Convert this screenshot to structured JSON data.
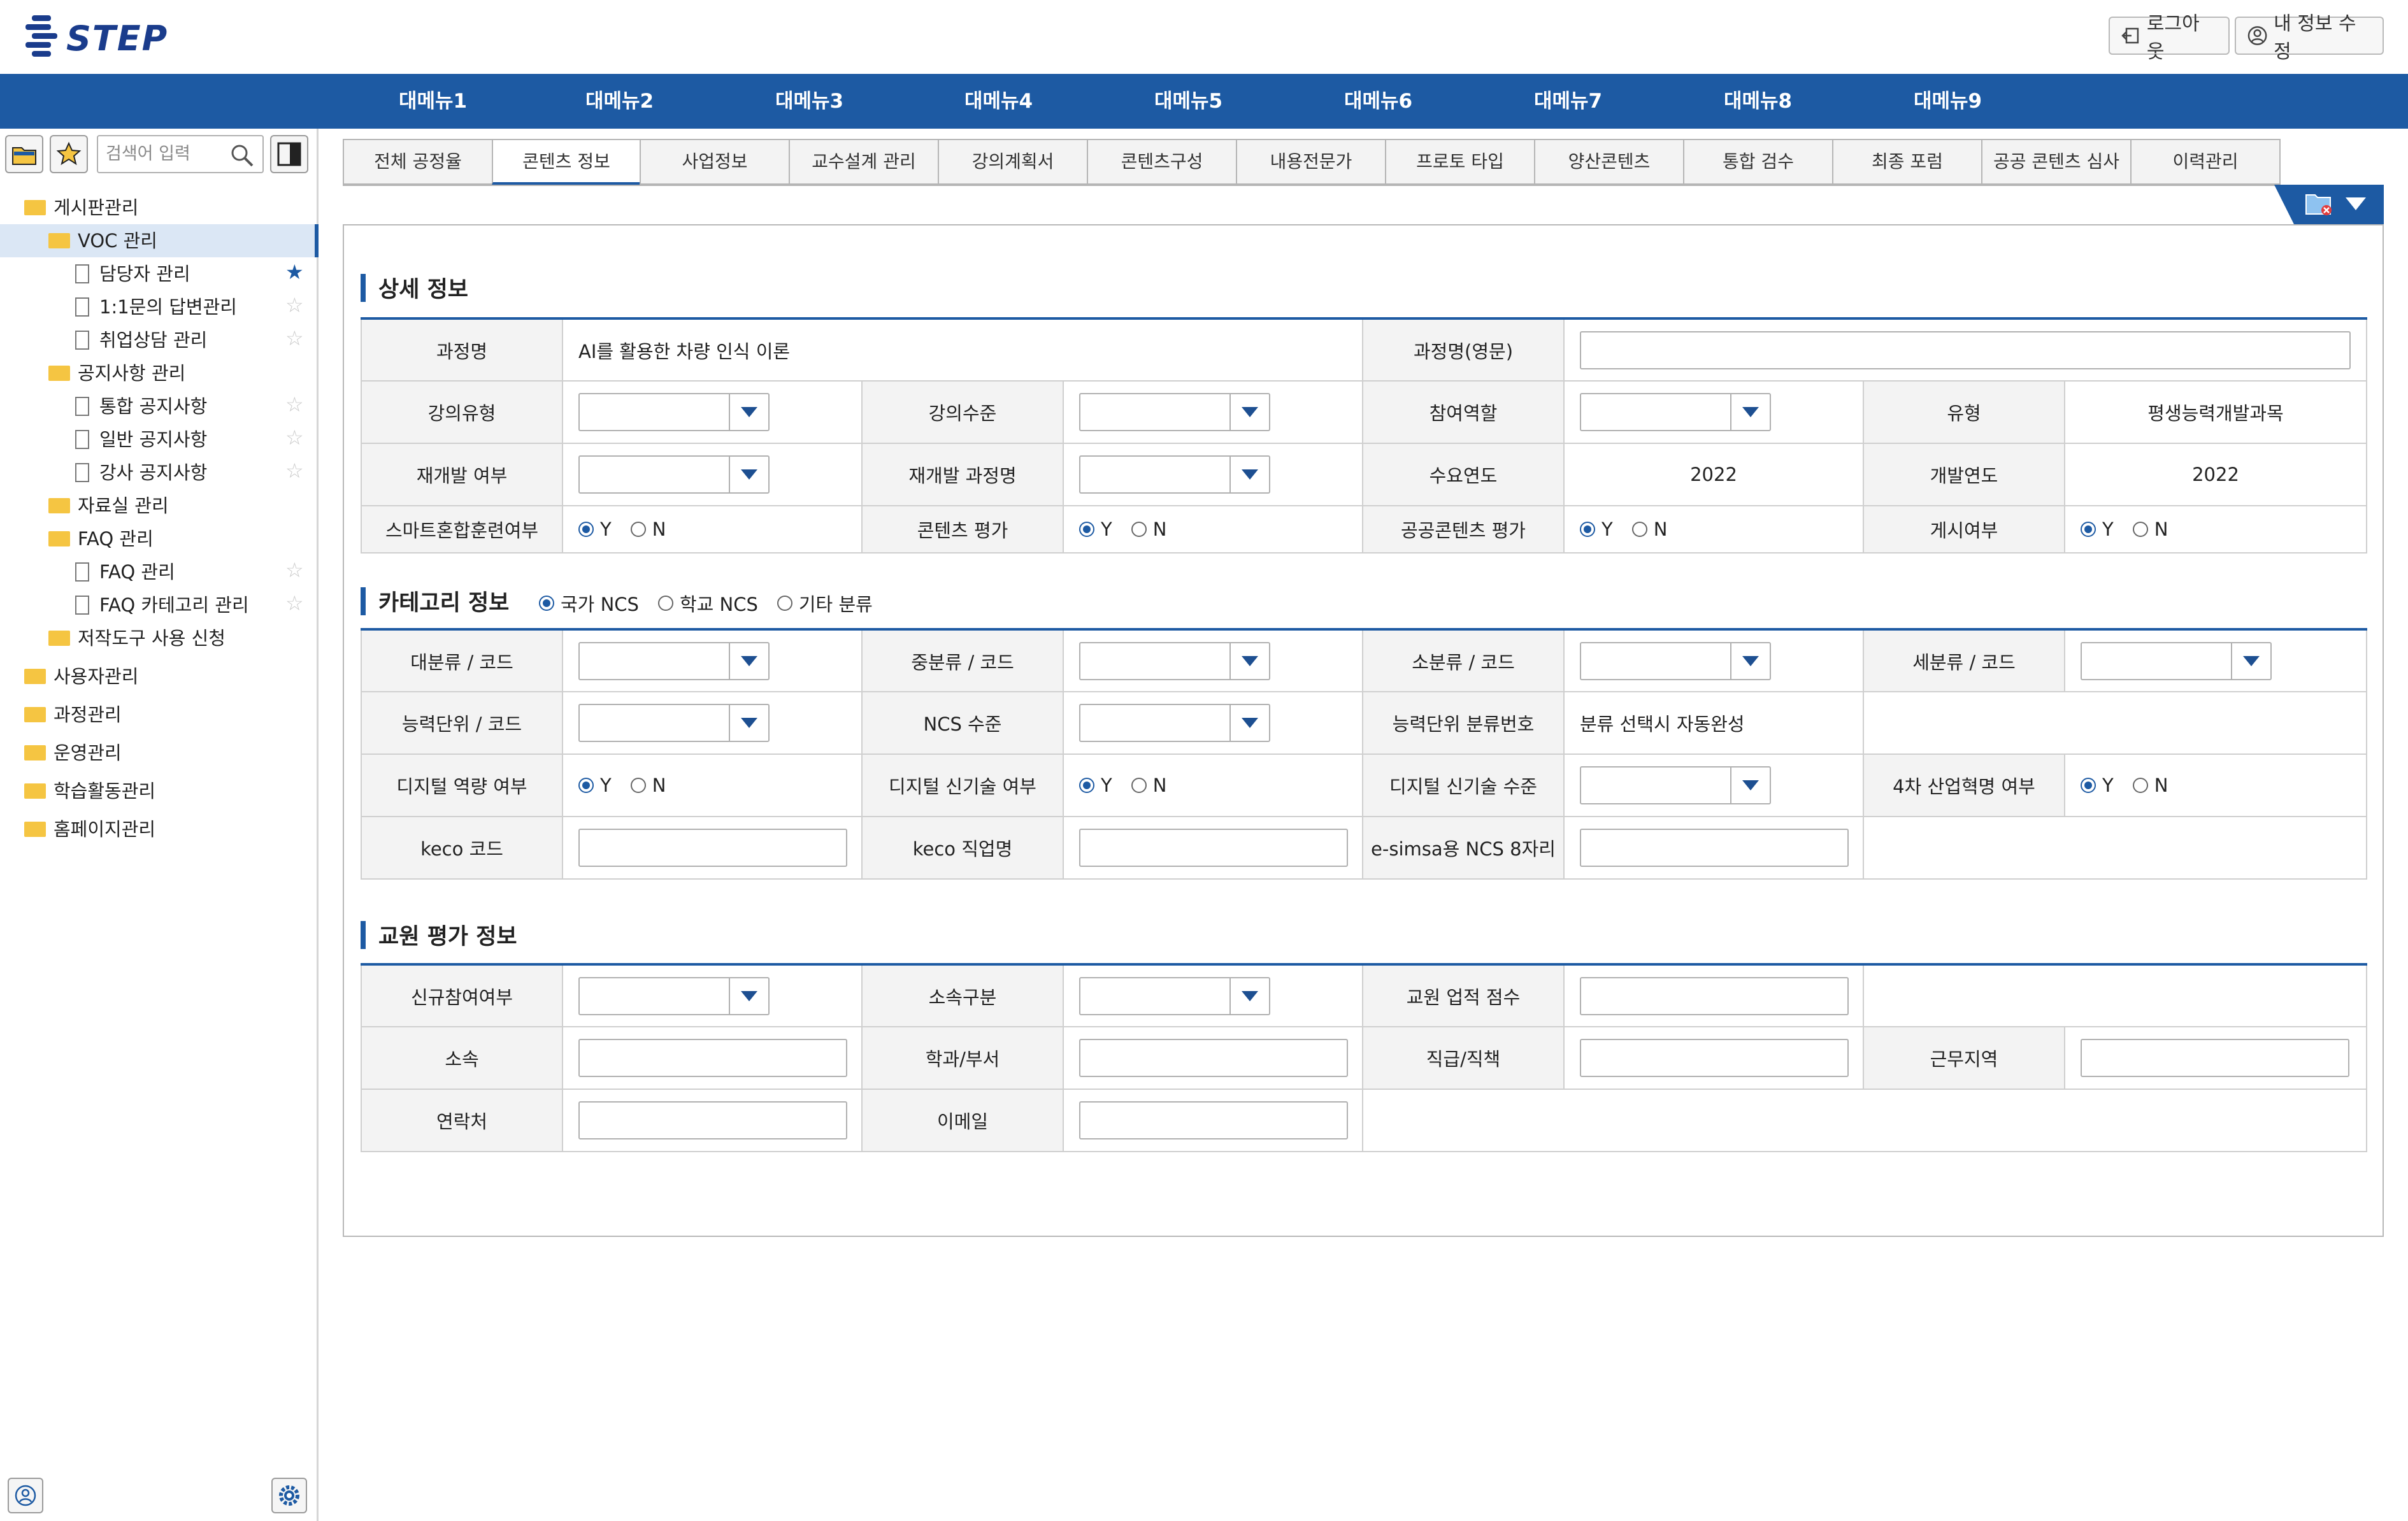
{
  "header": {
    "logo_text": "STEP",
    "logout_label": "로그아웃",
    "profile_label": "내 정보 수정"
  },
  "menu": [
    "대메뉴1",
    "대메뉴2",
    "대메뉴3",
    "대메뉴4",
    "대메뉴5",
    "대메뉴6",
    "대메뉴7",
    "대메뉴8",
    "대메뉴9"
  ],
  "sidebar": {
    "search_placeholder": "검색어 입력",
    "tree": {
      "board": "게시판관리",
      "voc": "VOC 관리",
      "manager": "담당자 관리",
      "qna": "1:1문의 답변관리",
      "job": "취업상담 관리",
      "notice": "공지사항 관리",
      "notice_all": "통합 공지사항",
      "notice_general": "일반 공지사항",
      "notice_lecturer": "강사 공지사항",
      "archive": "자료실 관리",
      "faq": "FAQ 관리",
      "faq_manage": "FAQ 관리",
      "faq_category": "FAQ 카테고리 관리",
      "copyright": "저작도구 사용 신청",
      "users": "사용자관리",
      "course": "과정관리",
      "operation": "운영관리",
      "learning": "학습활동관리",
      "homepage": "홈페이지관리"
    }
  },
  "tabs": [
    "전체 공정율",
    "콘텐츠 정보",
    "사업정보",
    "교수설계 관리",
    "강의계획서",
    "콘텐츠구성",
    "내용전문가",
    "프로토 타입",
    "양산콘텐츠",
    "통합 검수",
    "최종 포럼",
    "공공 콘텐츠 심사",
    "이력관리"
  ],
  "active_tab": "콘텐츠 정보",
  "detail": {
    "title": "상세 정보",
    "course_name_label": "과정명",
    "course_name_value": "AI를 활용한 차량 인식 이론",
    "course_name_en_label": "과정명(영문)",
    "lecture_type_label": "강의유형",
    "lecture_level_label": "강의수준",
    "role_label": "참여역할",
    "type_label": "유형",
    "type_value": "평생능력개발과목",
    "redev_label": "재개발 여부",
    "redev_course_label": "재개발 과정명",
    "demand_year_label": "수요연도",
    "demand_year_value": "2022",
    "dev_year_label": "개발연도",
    "dev_year_value": "2022",
    "smart_label": "스마트혼합훈련여부",
    "content_eval_label": "콘텐츠 평가",
    "public_eval_label": "공공콘텐츠 평가",
    "posted_label": "게시여부",
    "yes": "Y",
    "no": "N"
  },
  "category": {
    "title": "카테고리 정보",
    "radio_national": "국가 NCS",
    "radio_school": "학교 NCS",
    "radio_other": "기타 분류",
    "major_label": "대분류 / 코드",
    "middle_label": "중분류 / 코드",
    "minor_label": "소분류 / 코드",
    "detail_label": "세분류 / 코드",
    "unit_label": "능력단위 / 코드",
    "ncs_level_label": "NCS 수준",
    "unit_no_label": "능력단위 분류번호",
    "unit_no_value": "분류 선택시 자동완성",
    "digital_label": "디지털 역량 여부",
    "digital_new_label": "디지털 신기술 여부",
    "digital_new_level_label": "디지털 신기술 수준",
    "industry4_label": "4차 산업혁명 여부",
    "keco_code_label": "keco 코드",
    "keco_job_label": "keco 직업명",
    "esimsa_label": "e-simsa용 NCS 8자리"
  },
  "staff": {
    "title": "교원 평가 정보",
    "new_label": "신규참여여부",
    "belong_type_label": "소속구분",
    "score_label": "교원 업적 점수",
    "org_label": "소속",
    "dept_label": "학과/부서",
    "position_label": "직급/직책",
    "region_label": "근무지역",
    "contact_label": "연락처",
    "email_label": "이메일"
  },
  "colors": {
    "primary": "#1d5aa3",
    "accent_dark": "#1a3c8c",
    "folder": "#f5c542"
  }
}
